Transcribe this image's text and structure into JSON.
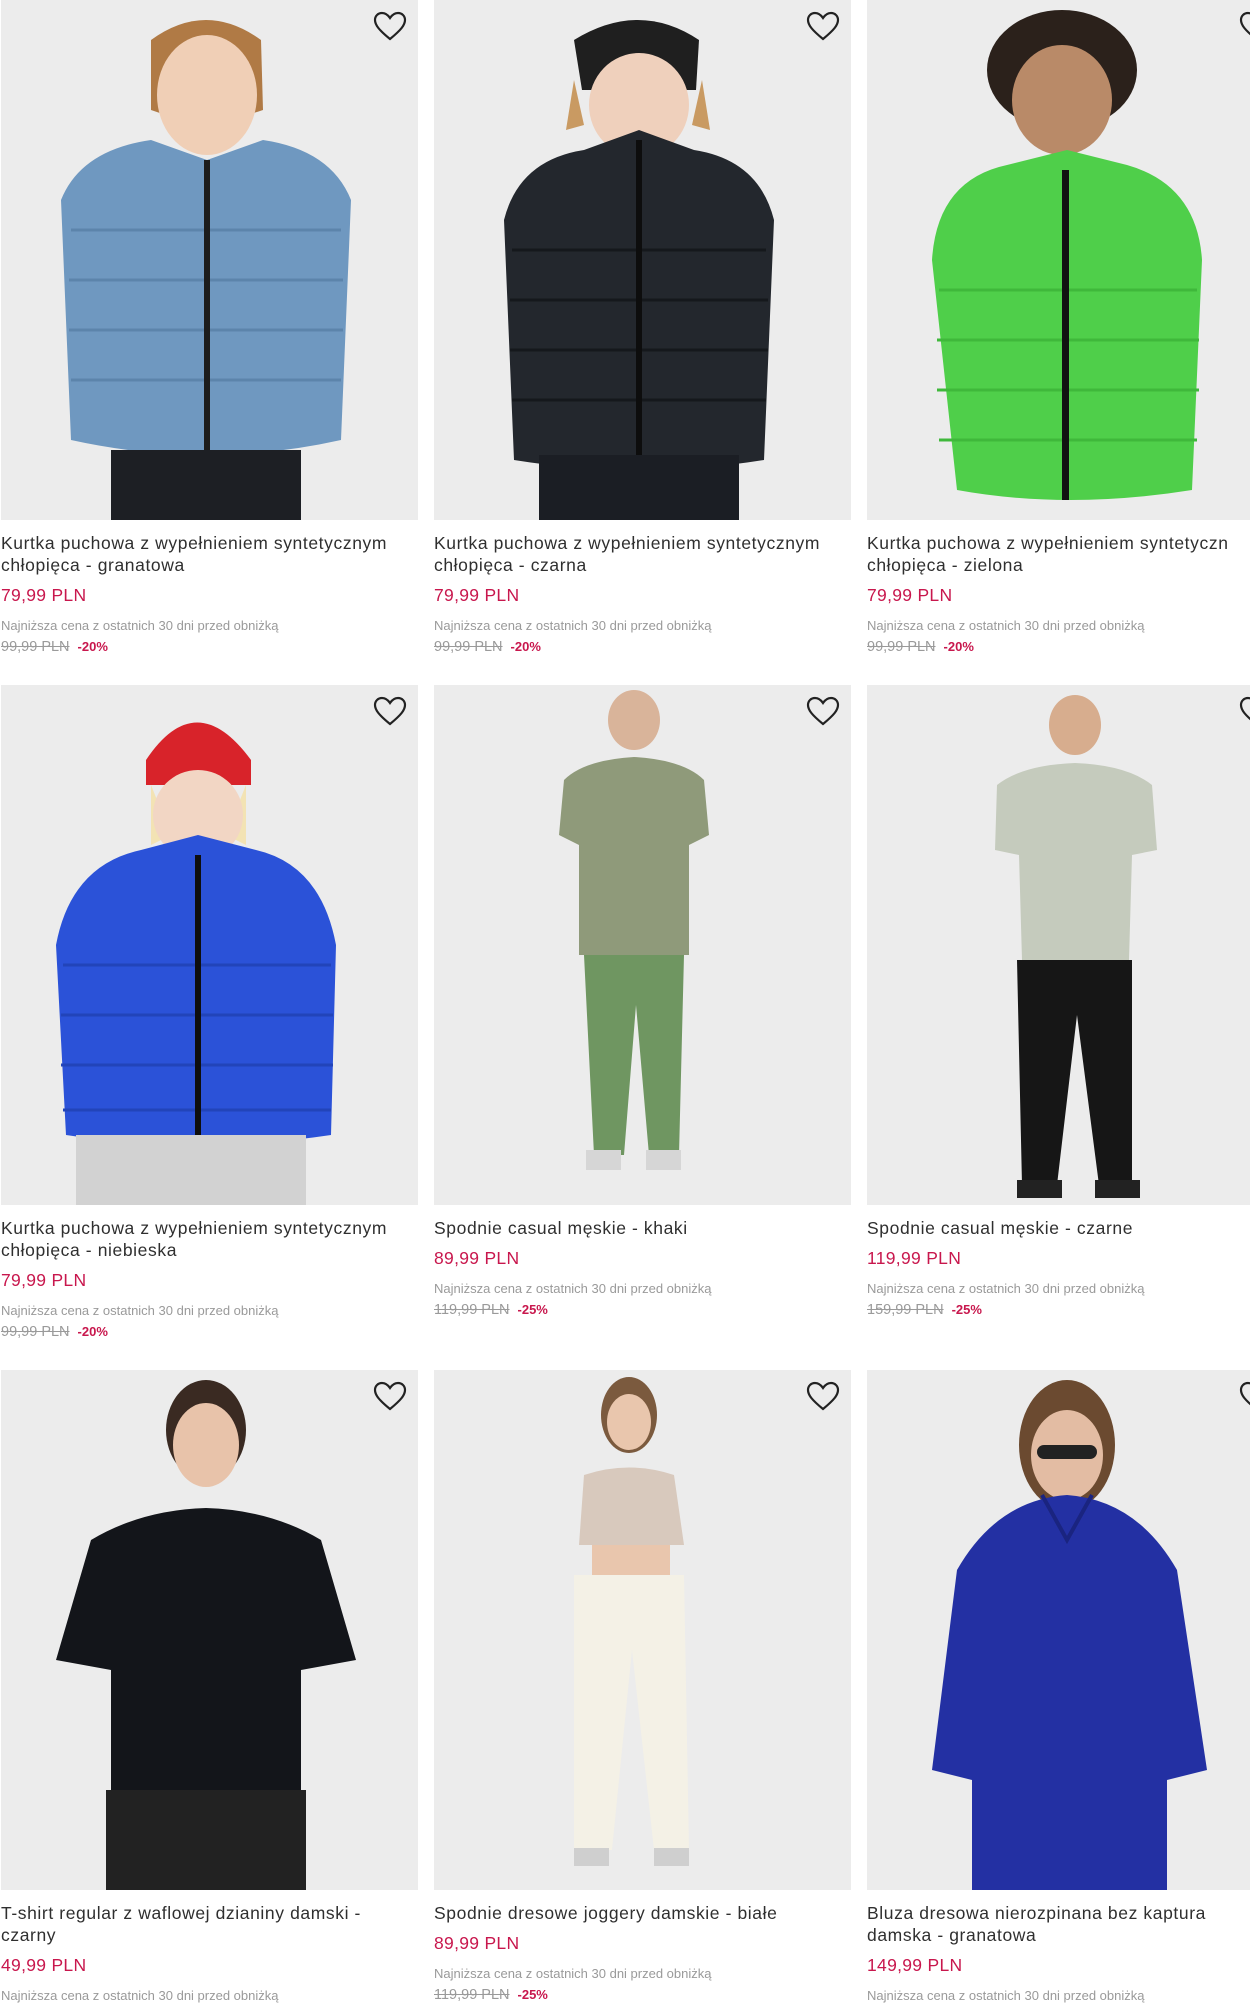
{
  "colors": {
    "price": "#c8174d",
    "muted": "#9a9a9a",
    "image_bg": "#eaeaea"
  },
  "products": [
    {
      "title": "Kurtka puchowa z wypełnieniem syntetycznym\nchłopięca - granatowa",
      "price": "79,99 PLN",
      "lowest_label": "Najniższa cena z ostatnich 30 dni przed obniżką",
      "old_price": "99,99 PLN",
      "discount": "-20%",
      "favorite_icon": "heart-outline-icon"
    },
    {
      "title": "Kurtka puchowa z wypełnieniem syntetycznym\nchłopięca - czarna",
      "price": "79,99 PLN",
      "lowest_label": "Najniższa cena z ostatnich 30 dni przed obniżką",
      "old_price": "99,99 PLN",
      "discount": "-20%",
      "favorite_icon": "heart-outline-icon"
    },
    {
      "title": "Kurtka puchowa z wypełnieniem syntetyczn\nchłopięca - zielona",
      "price": "79,99 PLN",
      "lowest_label": "Najniższa cena z ostatnich 30 dni przed obniżką",
      "old_price": "99,99 PLN",
      "discount": "-20%",
      "favorite_icon": "heart-outline-icon"
    },
    {
      "title": "Kurtka puchowa z wypełnieniem syntetycznym\nchłopięca - niebieska",
      "price": "79,99 PLN",
      "lowest_label": "Najniższa cena z ostatnich 30 dni przed obniżką",
      "old_price": "99,99 PLN",
      "discount": "-20%",
      "favorite_icon": "heart-outline-icon"
    },
    {
      "title": "Spodnie casual męskie - khaki",
      "price": "89,99 PLN",
      "lowest_label": "Najniższa cena z ostatnich 30 dni przed obniżką",
      "old_price": "119,99 PLN",
      "discount": "-25%",
      "favorite_icon": "heart-outline-icon"
    },
    {
      "title": "Spodnie casual męskie - czarne",
      "price": "119,99 PLN",
      "lowest_label": "Najniższa cena z ostatnich 30 dni przed obniżką",
      "old_price": "159,99 PLN",
      "discount": "-25%",
      "favorite_icon": "heart-outline-icon"
    },
    {
      "title": "T-shirt regular z waflowej dzianiny damski -\nczarny",
      "price": "49,99 PLN",
      "lowest_label": "Najniższa cena z ostatnich 30 dni przed obniżką",
      "old_price": "",
      "discount": "",
      "favorite_icon": "heart-outline-icon"
    },
    {
      "title": "Spodnie dresowe joggery damskie - białe",
      "price": "89,99 PLN",
      "lowest_label": "Najniższa cena z ostatnich 30 dni przed obniżką",
      "old_price": "119,99 PLN",
      "discount": "-25%",
      "favorite_icon": "heart-outline-icon"
    },
    {
      "title": "Bluza dresowa nierozpinana bez kaptura\ndamska - granatowa",
      "price": "149,99 PLN",
      "lowest_label": "Najniższa cena z ostatnich 30 dni przed obniżką",
      "old_price": "",
      "discount": "",
      "favorite_icon": "heart-outline-icon"
    }
  ]
}
